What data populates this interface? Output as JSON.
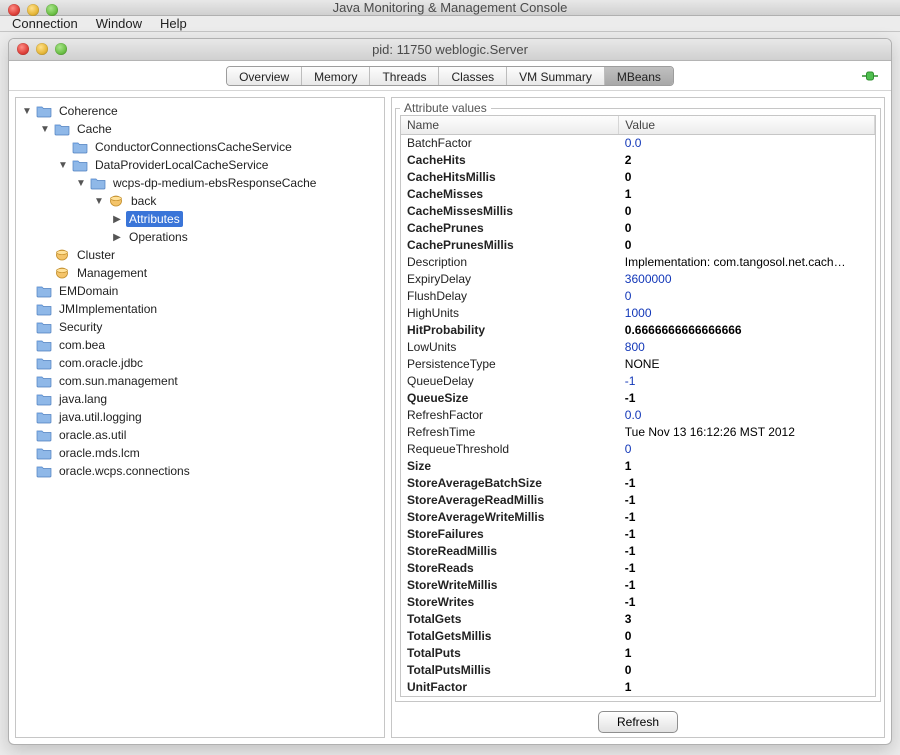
{
  "outer_title": "Java Monitoring & Management Console",
  "menubar": [
    "Connection",
    "Window",
    "Help"
  ],
  "inner_title": "pid: 11750 weblogic.Server",
  "tabs": [
    "Overview",
    "Memory",
    "Threads",
    "Classes",
    "VM Summary",
    "MBeans"
  ],
  "active_tab_index": 5,
  "tree": {
    "roots": [
      {
        "label": "Coherence",
        "expanded": true,
        "icon": "folder",
        "children": [
          {
            "label": "Cache",
            "expanded": true,
            "icon": "folder",
            "children": [
              {
                "label": "ConductorConnectionsCacheService",
                "expanded": false,
                "icon": "folder"
              },
              {
                "label": "DataProviderLocalCacheService",
                "expanded": true,
                "icon": "folder",
                "children": [
                  {
                    "label": "wcps-dp-medium-ebsResponseCache",
                    "expanded": true,
                    "icon": "folder",
                    "children": [
                      {
                        "label": "back",
                        "expanded": true,
                        "icon": "bean",
                        "children": [
                          {
                            "label": "Attributes",
                            "expanded": false,
                            "icon": "none",
                            "selected": true
                          },
                          {
                            "label": "Operations",
                            "expanded": false,
                            "icon": "none"
                          }
                        ]
                      }
                    ]
                  }
                ]
              }
            ]
          },
          {
            "label": "Cluster",
            "expanded": false,
            "icon": "bean"
          },
          {
            "label": "Management",
            "expanded": false,
            "icon": "bean"
          }
        ]
      },
      {
        "label": "EMDomain",
        "icon": "folder"
      },
      {
        "label": "JMImplementation",
        "icon": "folder"
      },
      {
        "label": "Security",
        "icon": "folder"
      },
      {
        "label": "com.bea",
        "icon": "folder"
      },
      {
        "label": "com.oracle.jdbc",
        "icon": "folder"
      },
      {
        "label": "com.sun.management",
        "icon": "folder"
      },
      {
        "label": "java.lang",
        "icon": "folder"
      },
      {
        "label": "java.util.logging",
        "icon": "folder"
      },
      {
        "label": "oracle.as.util",
        "icon": "folder"
      },
      {
        "label": "oracle.mds.lcm",
        "icon": "folder"
      },
      {
        "label": "oracle.wcps.connections",
        "icon": "folder"
      }
    ]
  },
  "attributes_panel": {
    "legend": "Attribute values",
    "col_name": "Name",
    "col_value": "Value",
    "refresh_label": "Refresh",
    "rows": [
      {
        "name": "BatchFactor",
        "value": "0.0",
        "link": true
      },
      {
        "name": "CacheHits",
        "value": "2",
        "bold": true
      },
      {
        "name": "CacheHitsMillis",
        "value": "0",
        "bold": true
      },
      {
        "name": "CacheMisses",
        "value": "1",
        "bold": true
      },
      {
        "name": "CacheMissesMillis",
        "value": "0",
        "bold": true
      },
      {
        "name": "CachePrunes",
        "value": "0",
        "bold": true
      },
      {
        "name": "CachePrunesMillis",
        "value": "0",
        "bold": true
      },
      {
        "name": "Description",
        "value": "Implementation: com.tangosol.net.cach…"
      },
      {
        "name": "ExpiryDelay",
        "value": "3600000",
        "link": true
      },
      {
        "name": "FlushDelay",
        "value": "0",
        "link": true
      },
      {
        "name": "HighUnits",
        "value": "1000",
        "link": true
      },
      {
        "name": "HitProbability",
        "value": "0.6666666666666666",
        "bold": true
      },
      {
        "name": "LowUnits",
        "value": "800",
        "link": true
      },
      {
        "name": "PersistenceType",
        "value": "NONE"
      },
      {
        "name": "QueueDelay",
        "value": "-1",
        "link": true
      },
      {
        "name": "QueueSize",
        "value": "-1",
        "bold": true
      },
      {
        "name": "RefreshFactor",
        "value": "0.0",
        "link": true
      },
      {
        "name": "RefreshTime",
        "value": "Tue Nov 13 16:12:26 MST 2012"
      },
      {
        "name": "RequeueThreshold",
        "value": "0",
        "link": true
      },
      {
        "name": "Size",
        "value": "1",
        "bold": true
      },
      {
        "name": "StoreAverageBatchSize",
        "value": "-1",
        "bold": true
      },
      {
        "name": "StoreAverageReadMillis",
        "value": "-1",
        "bold": true
      },
      {
        "name": "StoreAverageWriteMillis",
        "value": "-1",
        "bold": true
      },
      {
        "name": "StoreFailures",
        "value": "-1",
        "bold": true
      },
      {
        "name": "StoreReadMillis",
        "value": "-1",
        "bold": true
      },
      {
        "name": "StoreReads",
        "value": "-1",
        "bold": true
      },
      {
        "name": "StoreWriteMillis",
        "value": "-1",
        "bold": true
      },
      {
        "name": "StoreWrites",
        "value": "-1",
        "bold": true
      },
      {
        "name": "TotalGets",
        "value": "3",
        "bold": true
      },
      {
        "name": "TotalGetsMillis",
        "value": "0",
        "bold": true
      },
      {
        "name": "TotalPuts",
        "value": "1",
        "bold": true
      },
      {
        "name": "TotalPutsMillis",
        "value": "0",
        "bold": true
      },
      {
        "name": "UnitFactor",
        "value": "1",
        "bold": true
      }
    ]
  }
}
